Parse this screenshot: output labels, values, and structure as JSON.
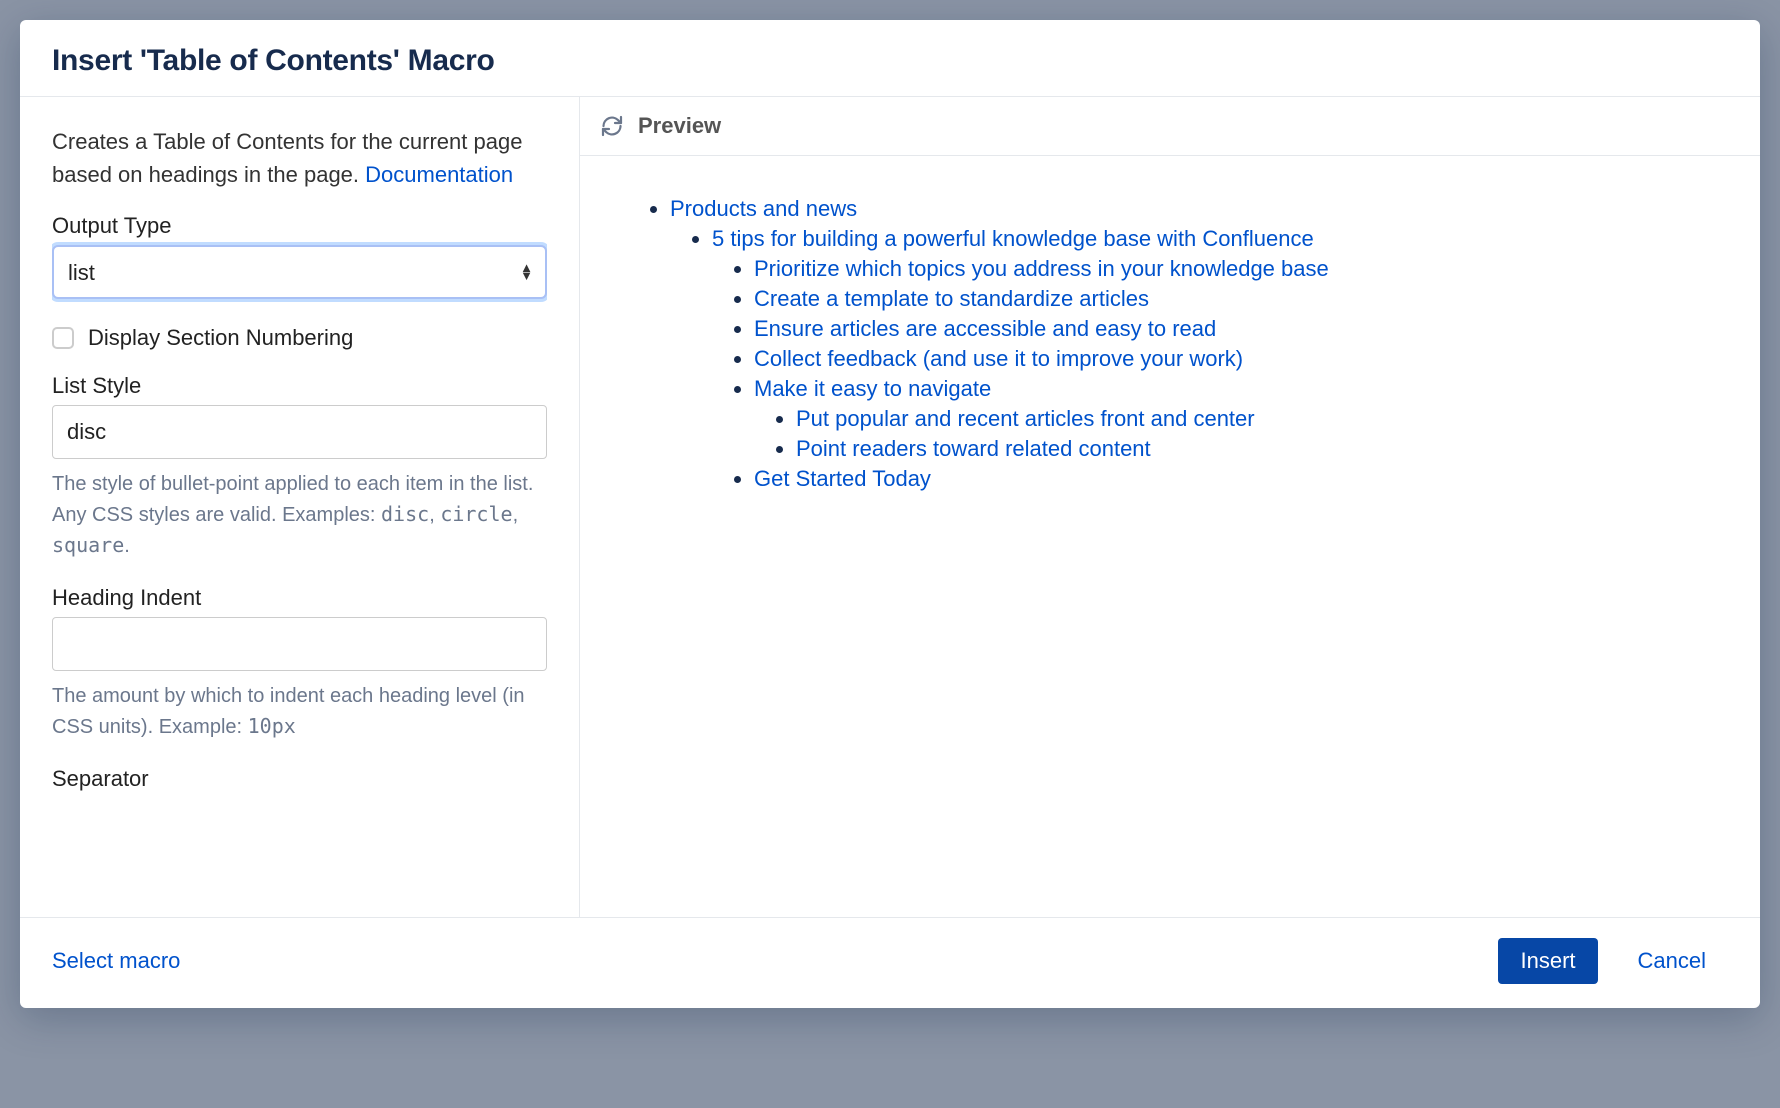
{
  "dialog": {
    "title": "Insert 'Table of Contents' Macro",
    "description_prefix": "Creates a Table of Contents for the current page based on headings in the page. ",
    "documentation_link": "Documentation"
  },
  "fields": {
    "output_type": {
      "label": "Output Type",
      "value": "list"
    },
    "display_section_numbering": {
      "label": "Display Section Numbering"
    },
    "list_style": {
      "label": "List Style",
      "value": "disc",
      "help_pre": "The style of bullet-point applied to each item in the list. Any CSS styles are valid. Examples: ",
      "ex1": "disc",
      "ex2": "circle",
      "ex3": "square"
    },
    "heading_indent": {
      "label": "Heading Indent",
      "value": "",
      "help_pre": "The amount by which to indent each heading level (in CSS units). Example: ",
      "ex1": "10px"
    },
    "separator": {
      "label": "Separator"
    }
  },
  "preview": {
    "label": "Preview",
    "toc": {
      "l1": "Products and news",
      "l2": "5 tips for building a powerful knowledge base with Confluence",
      "l3a": "Prioritize which topics you address in your knowledge base",
      "l3b": "Create a template to standardize articles",
      "l3c": "Ensure articles are accessible and easy to read",
      "l3d": "Collect feedback (and use it to improve your work)",
      "l3e": "Make it easy to navigate",
      "l4a": "Put popular and recent articles front and center",
      "l4b": "Point readers toward related content",
      "l3f": "Get Started Today"
    }
  },
  "footer": {
    "select_macro": "Select macro",
    "insert": "Insert",
    "cancel": "Cancel"
  }
}
